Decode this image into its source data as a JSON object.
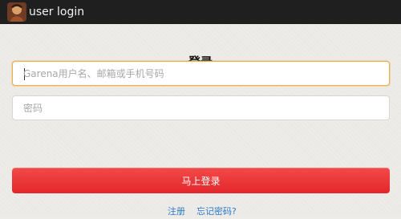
{
  "app": {
    "title": "user login",
    "icon": "user-avatar-icon"
  },
  "login": {
    "heading": "登录",
    "username_placeholder": "Garena用户名、邮箱或手机号码",
    "password_placeholder": "密码",
    "submit_label": "马上登录",
    "register_link": "注册",
    "forgot_password_link": "忘记密码?"
  },
  "colors": {
    "title_bar": "#1f1f1f",
    "background": "#eeece8",
    "primary_button": "#e83333",
    "focus_border": "#e9b04d",
    "link": "#2d79c7"
  }
}
